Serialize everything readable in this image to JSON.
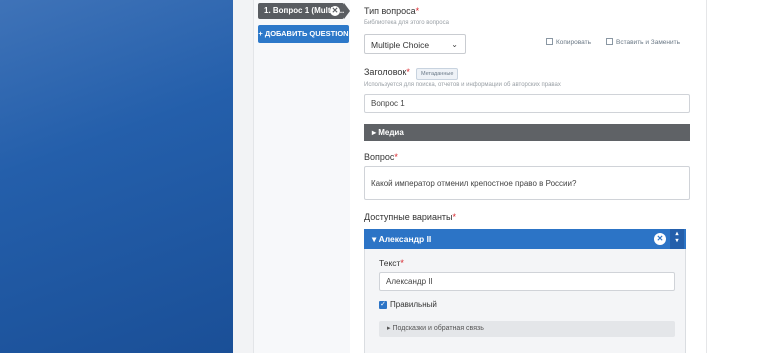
{
  "sidebar": {
    "question_tab_label": "1. Вопрос 1 (Multip...",
    "add_question_label": "+ ДОБАВИТЬ QUESTION"
  },
  "question_type": {
    "label": "Тип вопроса",
    "hint": "Библиотека для этого вопроса",
    "selected": "Multiple Choice",
    "copy_label": "Копировать",
    "paste_label": "Вставить и Заменить"
  },
  "title_field": {
    "label": "Заголовок",
    "badge": "Метаданные",
    "hint": "Используется для поиска, отчетов и информации об авторских правах",
    "value": "Вопрос 1"
  },
  "media": {
    "label": "▸ Медиа"
  },
  "question": {
    "label": "Вопрос",
    "value": "Какой император отменил крепостное право в России?"
  },
  "options": {
    "label": "Доступные варианты",
    "items": [
      {
        "header": "▾ Александр II",
        "text_label": "Текст",
        "text_value": "Александр II",
        "correct_label": "Правильный",
        "correct": true,
        "hints_label": "▸ Подсказки и обратная связь"
      }
    ]
  },
  "colors": {
    "accent": "#2c74c6",
    "required": "#d9262c",
    "dark_bar": "#5f6266"
  },
  "required_mark": "*"
}
